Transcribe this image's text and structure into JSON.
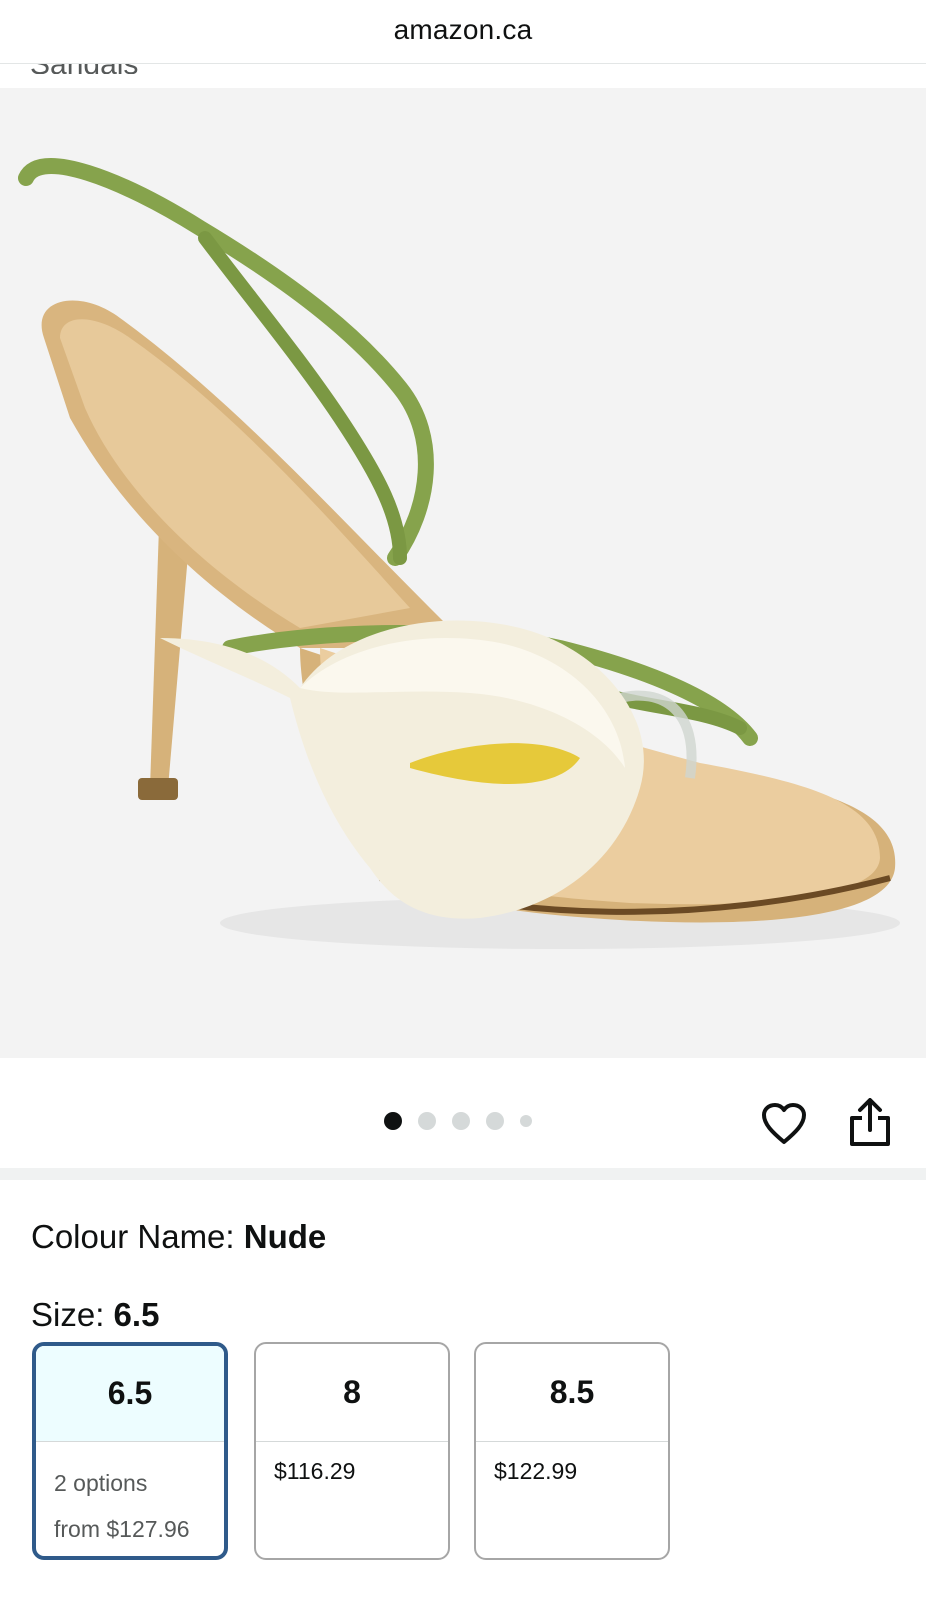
{
  "browser": {
    "url": "amazon.ca"
  },
  "breadcrumb": {
    "text": "Sandals"
  },
  "carousel": {
    "total": 5,
    "active_index": 0
  },
  "variation": {
    "colour_label": "Colour Name:",
    "colour_value": "Nude",
    "size_label": "Size:",
    "size_value": "6.5"
  },
  "sizes": [
    {
      "size": "6.5",
      "line1": "2 options",
      "line2": "from $127.96",
      "selected": true
    },
    {
      "size": "8",
      "line1": "$116.29",
      "line2": "",
      "selected": false
    },
    {
      "size": "8.5",
      "line1": "$122.99",
      "line2": "",
      "selected": false
    }
  ],
  "icons": {
    "wishlist": "heart-icon",
    "share": "share-icon"
  },
  "colors": {
    "selected_border": "#2f5a8a",
    "selected_bg": "#edfdff"
  }
}
